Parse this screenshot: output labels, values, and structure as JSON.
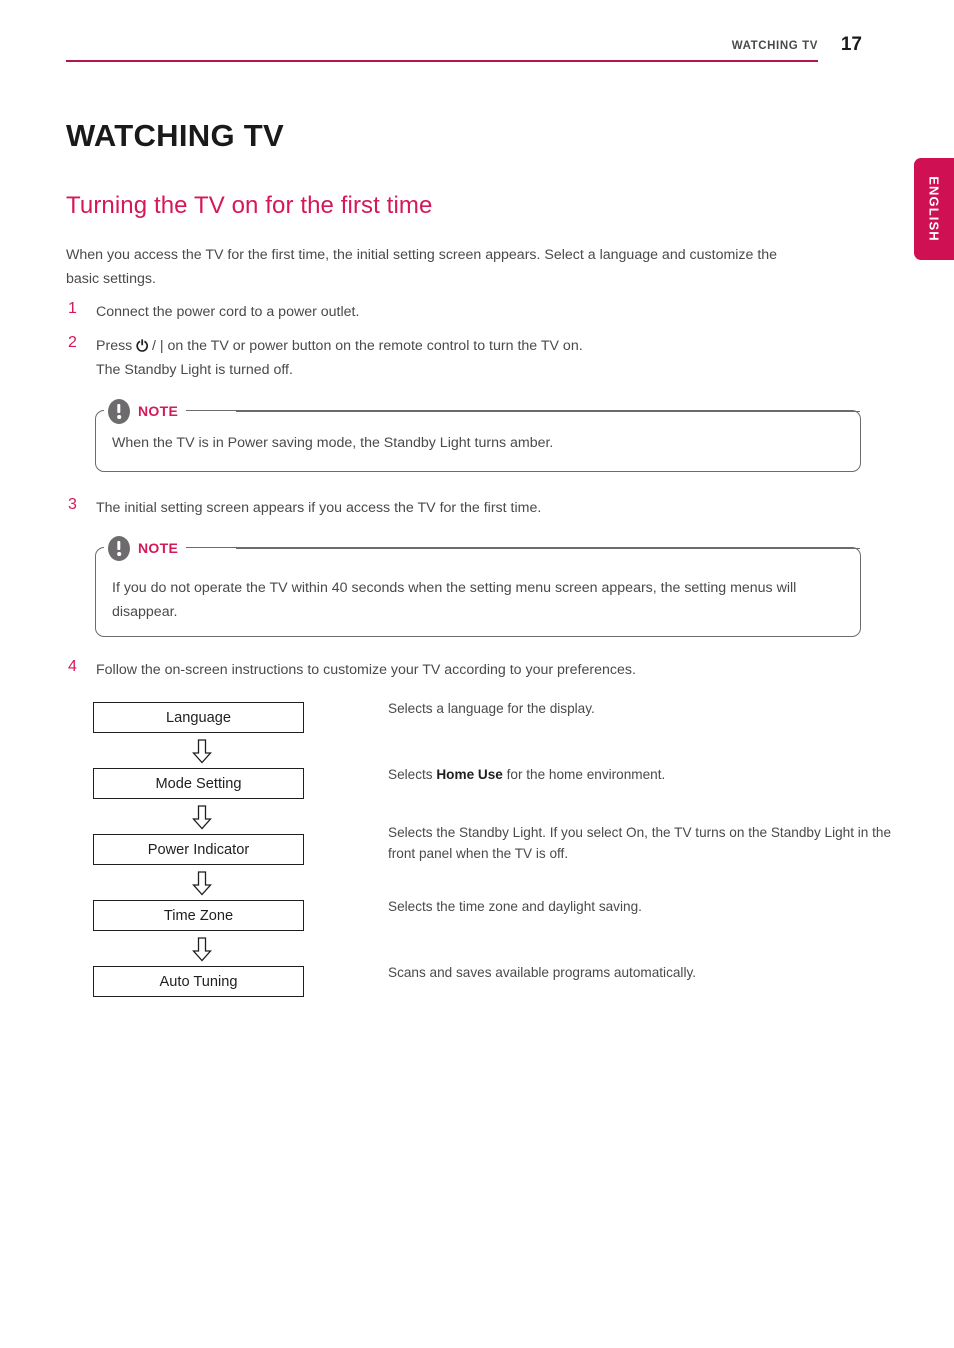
{
  "header": {
    "chapter": "WATCHING TV",
    "page_number": "17",
    "rule_color": "#b5154f"
  },
  "side_tab": {
    "label": "ENGLISH",
    "color": "#cf1053"
  },
  "chapter_title": "WATCHING TV",
  "section_title": "Turning the TV on for the first time",
  "accent_color": "#d4185a",
  "intro": "When you access the TV for the first time, the initial setting screen appears. Select a language and customize the basic settings.",
  "steps": [
    {
      "number": "1",
      "text": "Connect the power cord to a power outlet."
    },
    {
      "number": "2",
      "text_before": "Press ",
      "power_glyph": "⏻",
      "text_after": " / | on the TV or power button on the remote control to turn the TV on.",
      "second_line": "The Standby Light is turned off."
    },
    {
      "number": "3",
      "text": "The initial setting screen appears if you access the TV for the first time."
    },
    {
      "number": "4",
      "text": "Follow the on-screen instructions to customize your TV according to your preferences."
    }
  ],
  "notes": [
    {
      "label": "NOTE",
      "body": "When the TV is in Power saving mode, the Standby Light turns amber."
    },
    {
      "label": "NOTE",
      "body": "If you do not operate the TV within 40 seconds when the setting menu screen appears, the setting menus will disappear."
    }
  ],
  "flow": [
    {
      "box": "Language",
      "desc": "Selects a language for the display."
    },
    {
      "box": "Mode Setting",
      "desc_before": "Selects ",
      "desc_bold": "Home Use",
      "desc_after": " for the home environment."
    },
    {
      "box": "Power Indicator",
      "desc": "Selects the Standby Light. If you select On, the TV turns on the Standby Light in the front panel when the TV is off."
    },
    {
      "box": "Time Zone",
      "desc": "Selects the time zone and daylight saving."
    },
    {
      "box": "Auto Tuning",
      "desc": "Scans and saves available programs automatically."
    }
  ],
  "icons": {
    "note_icon": "exclamation-circle-icon",
    "flow_arrow": "down-arrow-icon",
    "power": "power-icon"
  }
}
